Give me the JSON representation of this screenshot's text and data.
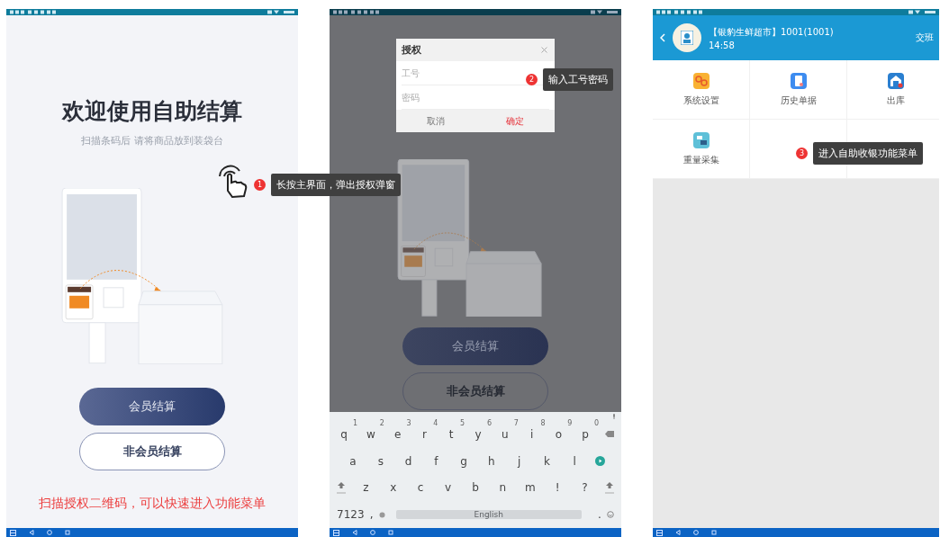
{
  "welcome_screen": {
    "title": "欢迎使用自助结算",
    "subtitle": "扫描条码后 请将商品放到装袋台",
    "buttons": [
      {
        "label": "会员结算",
        "kind": "primary"
      },
      {
        "label": "非会员结算",
        "kind": "outline"
      }
    ],
    "note": "扫描授权二维码，可以快速进入功能菜单"
  },
  "auth_screen": {
    "dialog": {
      "title": "授权",
      "fields": [
        {
          "placeholder": "工号"
        },
        {
          "placeholder": "密码"
        }
      ],
      "buttons": [
        {
          "label": "取消",
          "kind": "cancel"
        },
        {
          "label": "确定",
          "kind": "confirm"
        }
      ]
    },
    "buttons": [
      {
        "label": "会员结算",
        "kind": "primary"
      },
      {
        "label": "非会员结算",
        "kind": "outline"
      }
    ],
    "keyboard": {
      "rows": [
        [
          {
            "kind": "char",
            "label": "q",
            "hint": "1"
          },
          {
            "kind": "char",
            "label": "w",
            "hint": "2"
          },
          {
            "kind": "char",
            "label": "e",
            "hint": "3"
          },
          {
            "kind": "char",
            "label": "r",
            "hint": "4"
          },
          {
            "kind": "char",
            "label": "t",
            "hint": "5"
          },
          {
            "kind": "char",
            "label": "y",
            "hint": "6"
          },
          {
            "kind": "char",
            "label": "u",
            "hint": "7"
          },
          {
            "kind": "char",
            "label": "i",
            "hint": "8"
          },
          {
            "kind": "char",
            "label": "o",
            "hint": "9"
          },
          {
            "kind": "char",
            "label": "p",
            "hint": "0"
          },
          {
            "kind": "backspace"
          }
        ],
        [
          {
            "kind": "char",
            "label": "a"
          },
          {
            "kind": "char",
            "label": "s"
          },
          {
            "kind": "char",
            "label": "d"
          },
          {
            "kind": "char",
            "label": "f"
          },
          {
            "kind": "char",
            "label": "g"
          },
          {
            "kind": "char",
            "label": "h"
          },
          {
            "kind": "char",
            "label": "j"
          },
          {
            "kind": "char",
            "label": "k"
          },
          {
            "kind": "char",
            "label": "l"
          },
          {
            "kind": "enter"
          }
        ],
        [
          {
            "kind": "shift"
          },
          {
            "kind": "char",
            "label": "z"
          },
          {
            "kind": "char",
            "label": "x"
          },
          {
            "kind": "char",
            "label": "c"
          },
          {
            "kind": "char",
            "label": "v"
          },
          {
            "kind": "char",
            "label": "b"
          },
          {
            "kind": "char",
            "label": "n"
          },
          {
            "kind": "char",
            "label": "m"
          },
          {
            "kind": "char",
            "label": "!"
          },
          {
            "kind": "char",
            "label": "?"
          },
          {
            "kind": "shift"
          }
        ]
      ],
      "bottom_row": [
        {
          "kind": "char",
          "label": "7123"
        },
        {
          "kind": "char",
          "label": ","
        },
        {
          "kind": "settings"
        },
        {
          "kind": "space",
          "label": "English"
        },
        {
          "kind": "char",
          "label": "."
        },
        {
          "kind": "emoji"
        }
      ]
    }
  },
  "menu_screen": {
    "header": {
      "store": "【银豹生鲜超市】1001(1001)",
      "time": "14:58",
      "action": "交班"
    },
    "items": [
      {
        "label": "系统设置",
        "kind": "settings"
      },
      {
        "label": "历史单据",
        "kind": "history"
      },
      {
        "label": "出库",
        "kind": "outbound"
      },
      {
        "label": "重量采集",
        "kind": "weight"
      }
    ]
  },
  "callouts": [
    {
      "number": "1",
      "text": "长按主界面，弹出授权弹窗"
    },
    {
      "number": "2",
      "text": "输入工号密码"
    },
    {
      "number": "3",
      "text": "进入自助收银功能菜单"
    }
  ]
}
